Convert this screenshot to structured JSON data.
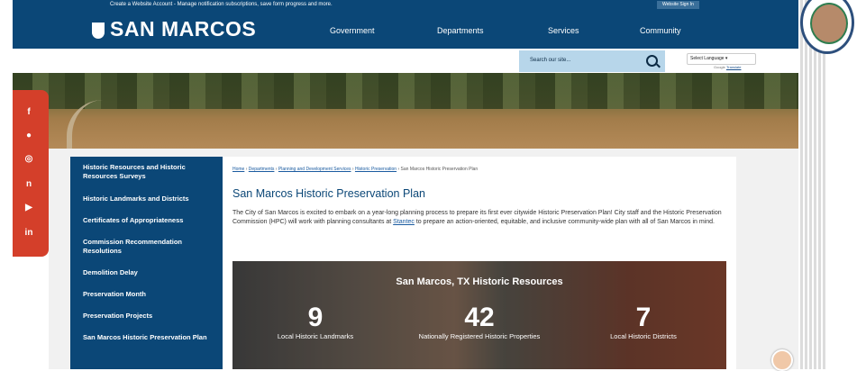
{
  "topbar": {
    "message": "Create a Website Account - Manage notification subscriptions, save form progress and more.",
    "signin": "Website Sign In"
  },
  "header": {
    "logo": "SAN MARCOS",
    "nav": [
      "Government",
      "Departments",
      "Services",
      "Community"
    ]
  },
  "search": {
    "placeholder": "Search our site...",
    "language_label": "Select Language",
    "powered_by": "Google",
    "translate": "Translate"
  },
  "social_icons": [
    "facebook-icon",
    "twitter-icon",
    "instagram-icon",
    "nextdoor-icon",
    "youtube-icon",
    "linkedin-icon"
  ],
  "sidebar": {
    "items": [
      "Historic Resources and Historic Resources Surveys",
      "Historic Landmarks and Districts",
      "Certificates of Appropriateness",
      "Commission Recommendation Resolutions",
      "Demolition Delay",
      "Preservation Month",
      "Preservation Projects",
      "San Marcos Historic Preservation Plan"
    ]
  },
  "breadcrumb": {
    "links": [
      "Home",
      "Departments",
      "Planning and Development Services",
      "Historic Preservation"
    ],
    "current": "San Marcos Historic Preservation Plan"
  },
  "page": {
    "title": "San Marcos Historic Preservation Plan",
    "intro_before": "The City of San Marcos is excited to embark on a year-long planning process to prepare its first ever citywide Historic Preservation Plan! City staff and the Historic Preservation Commission (HPC) will work with planning consultants at ",
    "intro_link": "Stantec",
    "intro_after": " to prepare an action-oriented, equitable, and inclusive community-wide plan with all of San Marcos in mind."
  },
  "banner": {
    "title": "San Marcos, TX Historic Resources",
    "stats": [
      {
        "value": "9",
        "label": "Local Historic Landmarks"
      },
      {
        "value": "42",
        "label": "Nationally Registered Historic Properties"
      },
      {
        "value": "7",
        "label": "Local Historic Districts"
      }
    ]
  },
  "colors": {
    "primary": "#0b4777",
    "social": "#d43f2a",
    "link": "#1a5ba0"
  }
}
